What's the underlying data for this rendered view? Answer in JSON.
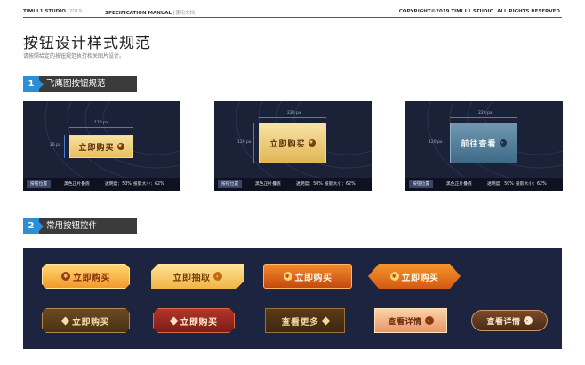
{
  "header": {
    "studio": "TIMI L1 STUDIO.",
    "year": "2019",
    "manual": "SPECIFICATION MANUAL",
    "manual_note": "[使用文档]",
    "copyright": "COPYRIGHT©2019 TIMI L1 STUDIO. ALL RIGHTS RESERVED."
  },
  "page": {
    "title": "按钮设计样式规范",
    "subtitle": "请按照给定的按钮规范执行相关图片设计。"
  },
  "section1": {
    "number": "1",
    "label": "飞鹰图按钮规范",
    "panels": [
      {
        "button_label": "立即购买",
        "icon": "¥",
        "width_label": "120 px",
        "height_label": "26 px",
        "footer_tag": "按钮位置",
        "footer_1": "黑色正片叠底",
        "footer_2": "透明度：50%",
        "footer_3": "投影大小：62%"
      },
      {
        "button_label": "立即购买",
        "icon": "¥",
        "width_label": "220 px",
        "height_label": "120 px",
        "footer_tag": "按钮位置",
        "footer_1": "黑色正片叠底",
        "footer_2": "透明度：50%",
        "footer_3": "投影大小：62%"
      },
      {
        "button_label": "前往查看",
        "icon": "›",
        "width_label": "220 px",
        "height_label": "120 px",
        "footer_tag": "按钮位置",
        "footer_1": "黑色正片叠底",
        "footer_2": "透明度：50%",
        "footer_3": "投影大小：62%"
      }
    ]
  },
  "section2": {
    "number": "2",
    "label": "常用按钮控件",
    "buttons": {
      "b1": "立即购买",
      "b2": "立即抽取",
      "b3": "立即购买",
      "b4": "立即购买",
      "b5": "立即购买",
      "b6": "立即购买",
      "b7": "查看更多",
      "b8": "查看详情",
      "b9": "查看详情"
    }
  },
  "colors": {
    "accent_blue": "#2a8fd6",
    "panel_bg": "#1b2238",
    "controls_bg": "#1d2440",
    "gold": "#e8c56a",
    "orange": "#e0691c"
  }
}
